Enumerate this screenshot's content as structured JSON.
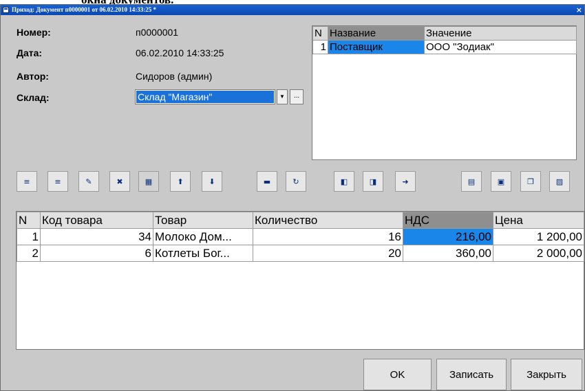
{
  "top_caption": "окна документов.",
  "window": {
    "title": "Приход: Документ п0000001 от 06.02.2010 14:33:25 *",
    "close": "×"
  },
  "form": {
    "number_label": "Номер:",
    "number_value": "п0000001",
    "date_label": "Дата:",
    "date_value": "06.02.2010 14:33:25",
    "author_label": "Автор:",
    "author_value": "Сидоров (админ)",
    "warehouse_label": "Склад:",
    "warehouse_value": "Склад \"Магазин\"",
    "dropdown_arrow": "▼",
    "browse_dots": "..."
  },
  "properties": {
    "columns": [
      "N",
      "Название",
      "Значение"
    ],
    "rows": [
      {
        "n": "1",
        "name": "Поставщик",
        "value": "ООО \"Зодиак\""
      }
    ]
  },
  "toolbar": [
    {
      "name": "add-row-button",
      "icon": "add-row-icon",
      "glyph": "≡"
    },
    {
      "name": "insert-row-button",
      "icon": "insert-row-icon",
      "glyph": "≡"
    },
    {
      "name": "edit-row-button",
      "icon": "edit-row-icon",
      "glyph": "✎"
    },
    {
      "name": "delete-row-button",
      "icon": "delete-row-icon",
      "glyph": "✖"
    },
    {
      "name": "end-edit-button",
      "icon": "end-edit-icon",
      "glyph": "▦"
    },
    {
      "name": "move-up-button",
      "icon": "arrow-up-icon",
      "glyph": "⬆"
    },
    {
      "name": "move-down-button",
      "icon": "arrow-down-icon",
      "glyph": "⬇"
    },
    {
      "name": "print-button",
      "icon": "printer-icon",
      "glyph": "▬"
    },
    {
      "name": "refresh-button",
      "icon": "refresh-icon",
      "glyph": "↻"
    },
    {
      "name": "import-button",
      "icon": "import-icon",
      "glyph": "◧"
    },
    {
      "name": "export-button",
      "icon": "export-icon",
      "glyph": "◨"
    },
    {
      "name": "go-forward-button",
      "icon": "forward-icon",
      "glyph": "➜"
    },
    {
      "name": "filter-button",
      "icon": "filter-icon",
      "glyph": "▤"
    },
    {
      "name": "calendar-button",
      "icon": "calendar-icon",
      "glyph": "▣"
    },
    {
      "name": "copy-button",
      "icon": "copy-icon",
      "glyph": "❐"
    },
    {
      "name": "paste-button",
      "icon": "paste-icon",
      "glyph": "▨"
    }
  ],
  "items": {
    "columns": [
      "N",
      "Код товара",
      "Товар",
      "Количество",
      "НДС",
      "Цена"
    ],
    "rows": [
      {
        "n": "1",
        "code": "34",
        "product": "Молоко Дом...",
        "qty": "16",
        "vat": "216,00",
        "price": "1 200,00"
      },
      {
        "n": "2",
        "code": "6",
        "product": "Котлеты Бог...",
        "qty": "20",
        "vat": "360,00",
        "price": "2 000,00"
      }
    ]
  },
  "buttons": {
    "ok": "OK",
    "save": "Записать",
    "close": "Закрыть"
  },
  "colors": {
    "window_bg": "#c9c9c9",
    "selection": "#1a86ea",
    "titlebar": "#0b48b3"
  }
}
